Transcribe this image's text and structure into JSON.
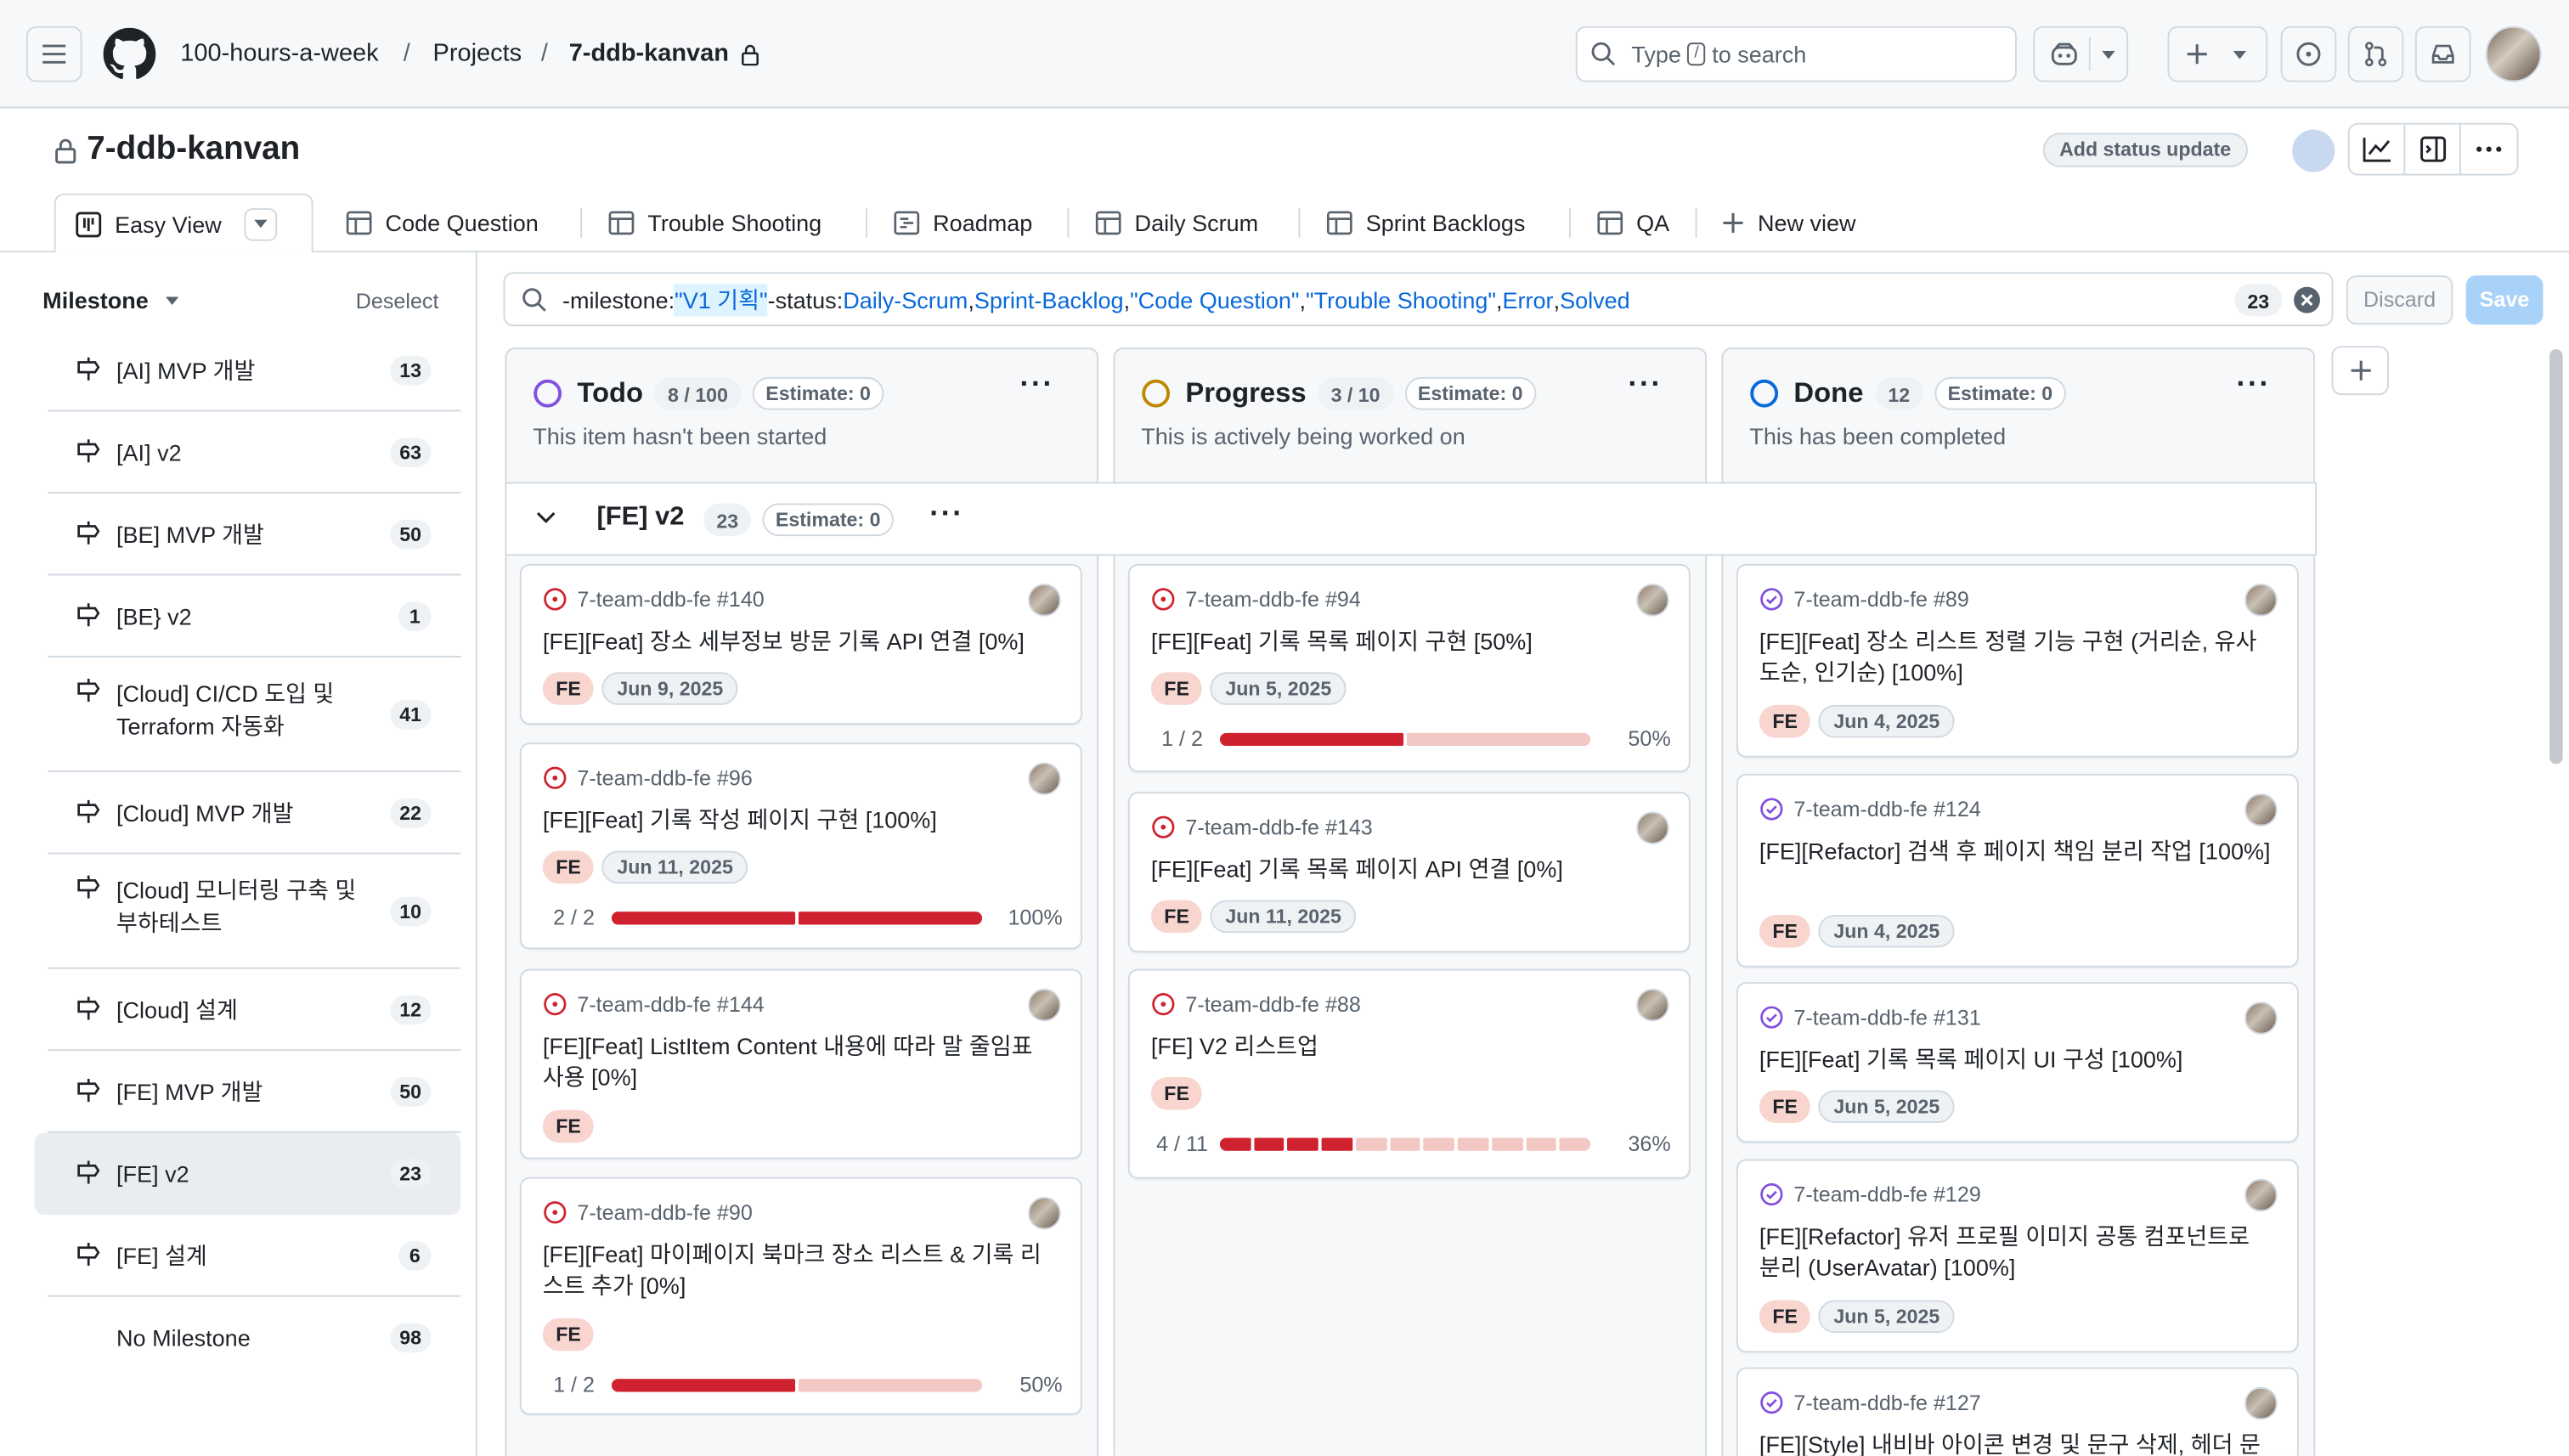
{
  "header": {
    "org": "100-hours-a-week",
    "projects": "Projects",
    "repo": "7-ddb-kanvan",
    "search_pre": "Type",
    "search_key": "/",
    "search_post": "to search"
  },
  "project": {
    "title": "7-ddb-kanvan",
    "status_button": "Add status update"
  },
  "tabs": [
    {
      "label": "Easy View"
    },
    {
      "label": "Code Question"
    },
    {
      "label": "Trouble Shooting"
    },
    {
      "label": "Roadmap"
    },
    {
      "label": "Daily Scrum"
    },
    {
      "label": "Sprint Backlogs"
    },
    {
      "label": "QA"
    },
    {
      "label": "New view"
    }
  ],
  "sidebar": {
    "title": "Milestone",
    "deselect": "Deselect",
    "items": [
      {
        "label": "[AI] MVP 개발",
        "count": "13"
      },
      {
        "label": "[AI] v2",
        "count": "63"
      },
      {
        "label": "[BE] MVP 개발",
        "count": "50"
      },
      {
        "label": "[BE} v2",
        "count": "1"
      },
      {
        "label": "[Cloud] CI/CD 도입 및 Terraform 자동화",
        "count": "41"
      },
      {
        "label": "[Cloud] MVP 개발",
        "count": "22"
      },
      {
        "label": "[Cloud] 모니터링 구축 및 부하테스트",
        "count": "10"
      },
      {
        "label": "[Cloud] 설계",
        "count": "12"
      },
      {
        "label": "[FE] MVP 개발",
        "count": "50"
      },
      {
        "label": "[FE] v2",
        "count": "23"
      },
      {
        "label": "[FE] 설계",
        "count": "6"
      },
      {
        "label": "No Milestone",
        "count": "98"
      }
    ]
  },
  "filter": {
    "neg_milestone": "-milestone:",
    "milestone_val": "\"V1 기획\"",
    "neg_status": " -status:",
    "status_vals": [
      "Daily-Scrum",
      "Sprint-Backlog",
      "\"Code Question\"",
      "\"Trouble Shooting\"",
      "Error",
      "Solved"
    ],
    "comma": ",",
    "count": "23",
    "discard": "Discard",
    "save": "Save"
  },
  "columns": [
    {
      "title": "Todo",
      "count": "8 / 100",
      "estimate": "Estimate: 0",
      "desc": "This item hasn't been started",
      "color": "#8250df"
    },
    {
      "title": "Progress",
      "count": "3 / 10",
      "estimate": "Estimate: 0",
      "desc": "This is actively being worked on",
      "color": "#bf8700"
    },
    {
      "title": "Done",
      "count": "12",
      "estimate": "Estimate: 0",
      "desc": "This has been completed",
      "color": "#0969da"
    }
  ],
  "group": {
    "title": "[FE] v2",
    "count": "23",
    "estimate": "Estimate: 0"
  },
  "cards": {
    "todo": [
      {
        "ref": "7-team-ddb-fe #140",
        "title": "[FE][Feat] 장소 세부정보 방문 기록 API 연결 [0%]",
        "label": "FE",
        "date": "Jun 9, 2025"
      },
      {
        "ref": "7-team-ddb-fe #96",
        "title": "[FE][Feat] 기록 작성 페이지 구현 [100%]",
        "label": "FE",
        "date": "Jun 11, 2025",
        "progress_text": "2 / 2",
        "percent": "100%",
        "progress": 1.0
      },
      {
        "ref": "7-team-ddb-fe #144",
        "title": "[FE][Feat] ListItem Content 내용에 따라 말 줄임표 사용 [0%]",
        "label": "FE"
      },
      {
        "ref": "7-team-ddb-fe #90",
        "title": "[FE][Feat] 마이페이지 북마크 장소 리스트 & 기록 리스트 추가 [0%]",
        "label": "FE",
        "progress_text": "1 / 2",
        "percent": "50%",
        "progress": 0.5
      }
    ],
    "progress": [
      {
        "ref": "7-team-ddb-fe #94",
        "title": "[FE][Feat] 기록 목록 페이지 구현 [50%]",
        "label": "FE",
        "date": "Jun 5, 2025",
        "progress_text": "1 / 2",
        "percent": "50%",
        "progress": 0.5
      },
      {
        "ref": "7-team-ddb-fe #143",
        "title": "[FE][Feat] 기록 목록 페이지 API 연결 [0%]",
        "label": "FE",
        "date": "Jun 11, 2025"
      },
      {
        "ref": "7-team-ddb-fe #88",
        "title": "[FE] V2 리스트업",
        "label": "FE",
        "progress_text": "4 / 11",
        "percent": "36%",
        "progress": 0.36
      }
    ],
    "done": [
      {
        "ref": "7-team-ddb-fe #89",
        "title": "[FE][Feat] 장소 리스트 정렬 기능 구현 (거리순, 유사도순, 인기순) [100%]",
        "label": "FE",
        "date": "Jun 4, 2025"
      },
      {
        "ref": "7-team-ddb-fe #124",
        "title": "[FE][Refactor] 검색 후 페이지 책임 분리 작업 [100%]",
        "label": "FE",
        "date": "Jun 4, 2025"
      },
      {
        "ref": "7-team-ddb-fe #131",
        "title": "[FE][Feat] 기록 목록 페이지 UI 구성 [100%]",
        "label": "FE",
        "date": "Jun 5, 2025"
      },
      {
        "ref": "7-team-ddb-fe #129",
        "title": "[FE][Refactor] 유저 프로필 이미지 공통 컴포넌트로 분리 (UserAvatar) [100%]",
        "label": "FE",
        "date": "Jun 5, 2025"
      },
      {
        "ref": "7-team-ddb-fe #127",
        "title": "[FE][Style] 내비바 아이콘 변경 및 문구 삭제, 헤더 문"
      }
    ]
  },
  "colors": {
    "accent": "#0969da",
    "progress_fill": "#cf222e",
    "progress_track": "#f3c7c4",
    "label_fe": "#f8d6cf"
  }
}
